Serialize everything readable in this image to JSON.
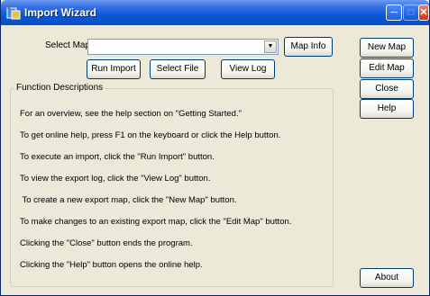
{
  "window": {
    "title": "Import Wizard"
  },
  "select_map": {
    "label": "Select Map:",
    "value": "",
    "dropdown_icon": "chevron-down-icon"
  },
  "buttons": {
    "map_info": "Map Info",
    "run_import": "Run Import",
    "select_file": "Select File",
    "view_log": "View Log",
    "new_map": "New Map",
    "edit_map": "Edit Map",
    "close": "Close",
    "help": "Help",
    "about": "About"
  },
  "function_descriptions": {
    "title": "Function Descriptions",
    "lines": [
      "For an overview, see the help section on \"Getting Started.\"",
      "To get online help, press F1 on the keyboard or click the Help button.",
      "To execute an import, click the \"Run Import\" button.",
      "To view the export log, click the \"View Log\" button.",
      " To create a new export map, click the \"New Map\" button.",
      "To make changes to an existing export map, click the \"Edit Map\" button.",
      "Clicking the \"Close\" button ends the program.",
      "Clicking the \"Help\" button opens the online help."
    ]
  },
  "colors": {
    "titlebar": "#0a58d6",
    "window_bg": "#ece9d8",
    "button_border": "#003c74"
  }
}
